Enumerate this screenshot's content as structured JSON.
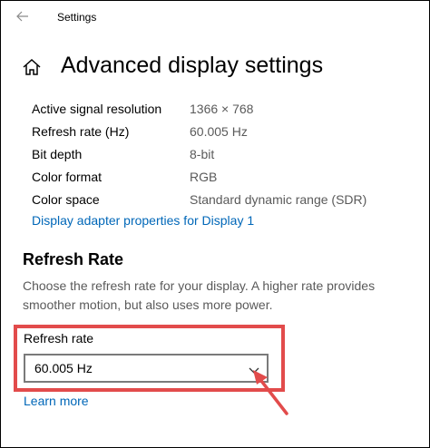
{
  "window": {
    "title": "Settings",
    "back_icon": "back-arrow-icon"
  },
  "page": {
    "title": "Advanced display settings",
    "home_icon": "home-icon"
  },
  "display_info": [
    {
      "label": "Active signal resolution",
      "value": "1366 × 768"
    },
    {
      "label": "Refresh rate (Hz)",
      "value": "60.005 Hz"
    },
    {
      "label": "Bit depth",
      "value": "8-bit"
    },
    {
      "label": "Color format",
      "value": "RGB"
    },
    {
      "label": "Color space",
      "value": "Standard dynamic range (SDR)"
    }
  ],
  "adapter_link": "Display adapter properties for Display 1",
  "refresh_section": {
    "heading": "Refresh Rate",
    "description": "Choose the refresh rate for your display. A higher rate provides smoother motion, but also uses more power.",
    "select_label": "Refresh rate",
    "selected_value": "60.005 Hz",
    "learn_more": "Learn more"
  },
  "colors": {
    "accent_link": "#0067b8",
    "annotation_red": "#e24b4b",
    "secondary_text": "#5a5a5a"
  }
}
